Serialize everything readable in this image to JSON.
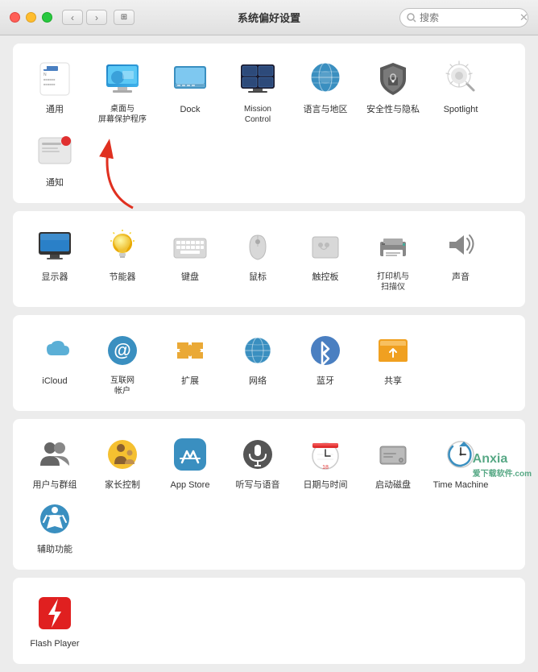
{
  "window": {
    "title": "系统偏好设置",
    "search_placeholder": "搜索"
  },
  "sections": {
    "row1": [
      {
        "id": "general",
        "label": "通用"
      },
      {
        "id": "desktop",
        "label": "桌面与\n屏幕保护程序"
      },
      {
        "id": "dock",
        "label": "Dock"
      },
      {
        "id": "mission",
        "label": "Mission\nControl"
      },
      {
        "id": "language",
        "label": "语言与地区"
      },
      {
        "id": "security",
        "label": "安全性与隐私"
      },
      {
        "id": "spotlight",
        "label": "Spotlight"
      },
      {
        "id": "notification",
        "label": "通知"
      }
    ],
    "row2": [
      {
        "id": "display",
        "label": "显示器"
      },
      {
        "id": "energy",
        "label": "节能器"
      },
      {
        "id": "keyboard",
        "label": "键盘"
      },
      {
        "id": "mouse",
        "label": "鼠标"
      },
      {
        "id": "trackpad",
        "label": "触控板"
      },
      {
        "id": "printer",
        "label": "打印机与\n扫描仪"
      },
      {
        "id": "sound",
        "label": "声音"
      }
    ],
    "row3": [
      {
        "id": "icloud",
        "label": "iCloud"
      },
      {
        "id": "internet",
        "label": "互联网\n帐户"
      },
      {
        "id": "extensions",
        "label": "扩展"
      },
      {
        "id": "network",
        "label": "网络"
      },
      {
        "id": "bluetooth",
        "label": "蓝牙"
      },
      {
        "id": "sharing",
        "label": "共享"
      }
    ],
    "row4": [
      {
        "id": "users",
        "label": "用户与群组"
      },
      {
        "id": "parental",
        "label": "家长控制"
      },
      {
        "id": "appstore",
        "label": "App Store"
      },
      {
        "id": "dictation",
        "label": "听写与语音"
      },
      {
        "id": "datetime",
        "label": "日期与时间"
      },
      {
        "id": "startup",
        "label": "启动磁盘"
      },
      {
        "id": "timemachine",
        "label": "Time Machine"
      },
      {
        "id": "accessibility",
        "label": "辅助功能"
      }
    ],
    "row5": [
      {
        "id": "flashplayer",
        "label": "Flash Player"
      }
    ]
  },
  "watermark": "Anxia\n爱下载软件",
  "watermark2": ".com"
}
